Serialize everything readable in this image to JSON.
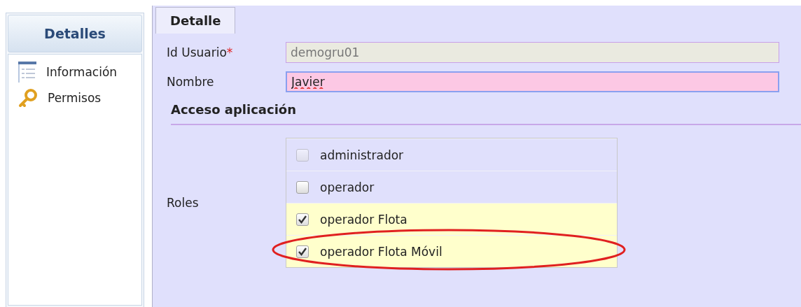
{
  "sidebar": {
    "title": "Detalles",
    "items": [
      {
        "label": "Información",
        "kind": "list"
      },
      {
        "label": "Permisos",
        "kind": "key"
      }
    ]
  },
  "tabs": [
    {
      "label": "Detalle",
      "selected": true
    }
  ],
  "fields": [
    {
      "label": "Id Usuario",
      "required_mark": "*",
      "value": "demogru01",
      "disabled": true,
      "invalid": false
    },
    {
      "label": "Nombre",
      "value": "Javier",
      "disabled": false,
      "invalid": true
    }
  ],
  "section": {
    "title": "Acceso aplicación"
  },
  "roles": {
    "label": "Roles",
    "options": [
      {
        "label": "administrador",
        "checked": false,
        "disabled": true
      },
      {
        "label": "operador",
        "checked": false,
        "disabled": false
      },
      {
        "label": "operador Flota",
        "checked": true,
        "disabled": false
      },
      {
        "label": "operador Flota Móvil",
        "checked": true,
        "disabled": false,
        "circled": true
      }
    ]
  }
}
